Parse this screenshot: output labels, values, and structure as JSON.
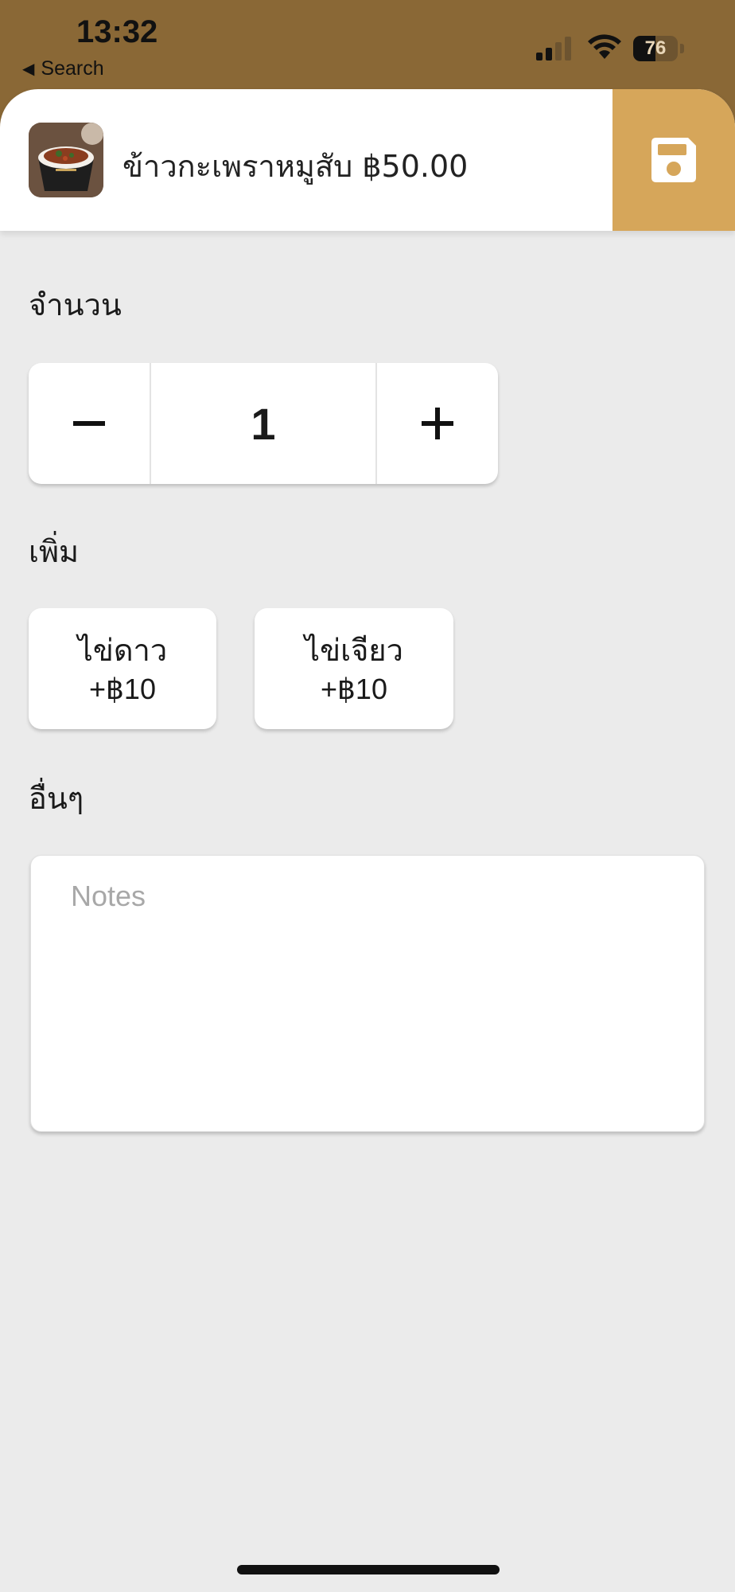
{
  "status_bar": {
    "time": "13:32",
    "back_label": "Search",
    "battery": "76",
    "icons": [
      "cellular-signal-icon",
      "wifi-icon",
      "battery-icon"
    ]
  },
  "header": {
    "title": "ข้าวกะเพราหมูสับ ฿50.00",
    "thumbnail": "food-bowl-thumbnail",
    "save_icon": "floppy-disk-icon"
  },
  "quantity": {
    "label": "จำนวน",
    "value": "1",
    "minus_icon": "minus-icon",
    "plus_icon": "plus-icon"
  },
  "addons": {
    "label": "เพิ่ม",
    "items": [
      {
        "name": "ไข่ดาว",
        "price": "+฿10"
      },
      {
        "name": "ไข่เจียว",
        "price": "+฿10"
      }
    ]
  },
  "other": {
    "label": "อื่นๆ",
    "notes_placeholder": "Notes",
    "notes_value": ""
  },
  "colors": {
    "status_bar_bg": "#8a6836",
    "accent": "#d6a65a",
    "page_bg": "#ebebeb"
  }
}
